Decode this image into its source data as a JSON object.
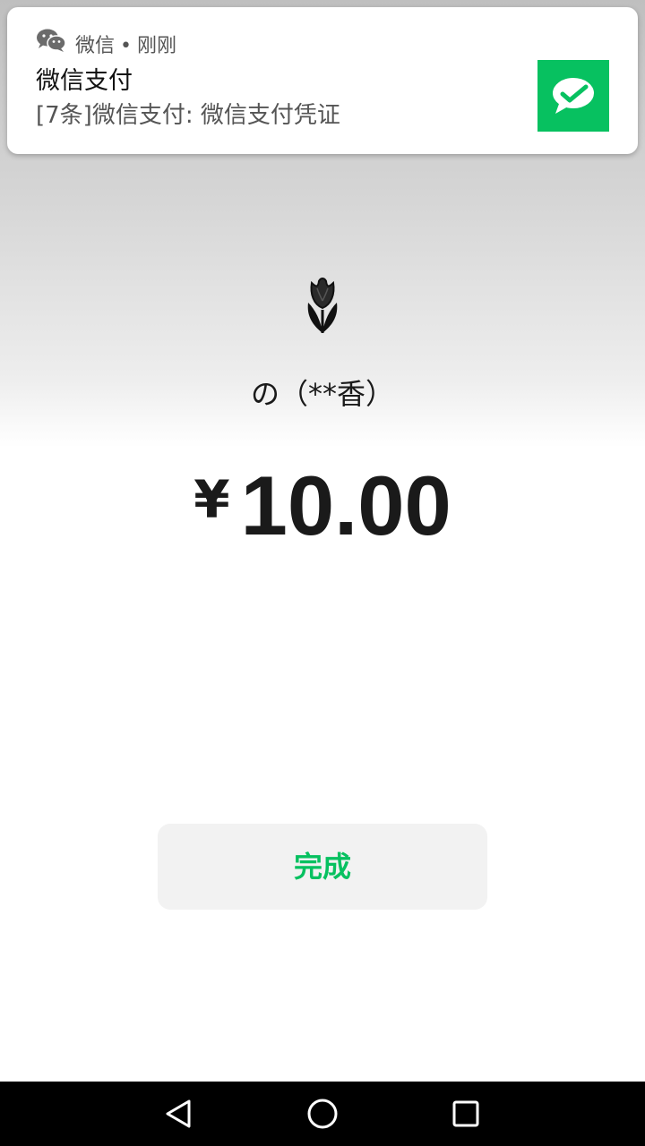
{
  "notification": {
    "app_name": "微信",
    "separator": "•",
    "time": "刚刚",
    "title": "微信支付",
    "body": "[7条]微信支付: 微信支付凭证",
    "accent_color": "#07c160",
    "app_icon": "wechat-icon",
    "thumbnail_icon": "wechat-pay-icon"
  },
  "payment": {
    "payee_name": "の（**香）",
    "currency_symbol": "¥",
    "amount": "10.00",
    "avatar_icon": "tulip-avatar-icon"
  },
  "actions": {
    "done_label": "完成"
  },
  "navbar": {
    "back_icon": "back-triangle-icon",
    "home_icon": "home-circle-icon",
    "recents_icon": "recents-square-icon"
  }
}
